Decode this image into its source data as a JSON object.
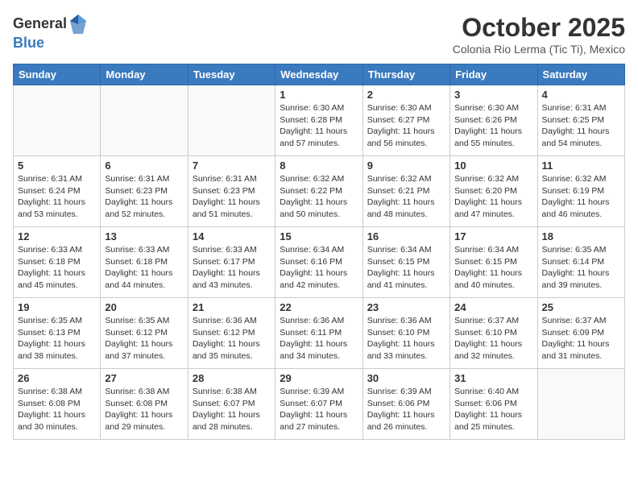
{
  "header": {
    "logo_general": "General",
    "logo_blue": "Blue",
    "month_title": "October 2025",
    "subtitle": "Colonia Rio Lerma (Tic Ti), Mexico"
  },
  "weekdays": [
    "Sunday",
    "Monday",
    "Tuesday",
    "Wednesday",
    "Thursday",
    "Friday",
    "Saturday"
  ],
  "weeks": [
    [
      {
        "day": "",
        "info": ""
      },
      {
        "day": "",
        "info": ""
      },
      {
        "day": "",
        "info": ""
      },
      {
        "day": "1",
        "info": "Sunrise: 6:30 AM\nSunset: 6:28 PM\nDaylight: 11 hours\nand 57 minutes."
      },
      {
        "day": "2",
        "info": "Sunrise: 6:30 AM\nSunset: 6:27 PM\nDaylight: 11 hours\nand 56 minutes."
      },
      {
        "day": "3",
        "info": "Sunrise: 6:30 AM\nSunset: 6:26 PM\nDaylight: 11 hours\nand 55 minutes."
      },
      {
        "day": "4",
        "info": "Sunrise: 6:31 AM\nSunset: 6:25 PM\nDaylight: 11 hours\nand 54 minutes."
      }
    ],
    [
      {
        "day": "5",
        "info": "Sunrise: 6:31 AM\nSunset: 6:24 PM\nDaylight: 11 hours\nand 53 minutes."
      },
      {
        "day": "6",
        "info": "Sunrise: 6:31 AM\nSunset: 6:23 PM\nDaylight: 11 hours\nand 52 minutes."
      },
      {
        "day": "7",
        "info": "Sunrise: 6:31 AM\nSunset: 6:23 PM\nDaylight: 11 hours\nand 51 minutes."
      },
      {
        "day": "8",
        "info": "Sunrise: 6:32 AM\nSunset: 6:22 PM\nDaylight: 11 hours\nand 50 minutes."
      },
      {
        "day": "9",
        "info": "Sunrise: 6:32 AM\nSunset: 6:21 PM\nDaylight: 11 hours\nand 48 minutes."
      },
      {
        "day": "10",
        "info": "Sunrise: 6:32 AM\nSunset: 6:20 PM\nDaylight: 11 hours\nand 47 minutes."
      },
      {
        "day": "11",
        "info": "Sunrise: 6:32 AM\nSunset: 6:19 PM\nDaylight: 11 hours\nand 46 minutes."
      }
    ],
    [
      {
        "day": "12",
        "info": "Sunrise: 6:33 AM\nSunset: 6:18 PM\nDaylight: 11 hours\nand 45 minutes."
      },
      {
        "day": "13",
        "info": "Sunrise: 6:33 AM\nSunset: 6:18 PM\nDaylight: 11 hours\nand 44 minutes."
      },
      {
        "day": "14",
        "info": "Sunrise: 6:33 AM\nSunset: 6:17 PM\nDaylight: 11 hours\nand 43 minutes."
      },
      {
        "day": "15",
        "info": "Sunrise: 6:34 AM\nSunset: 6:16 PM\nDaylight: 11 hours\nand 42 minutes."
      },
      {
        "day": "16",
        "info": "Sunrise: 6:34 AM\nSunset: 6:15 PM\nDaylight: 11 hours\nand 41 minutes."
      },
      {
        "day": "17",
        "info": "Sunrise: 6:34 AM\nSunset: 6:15 PM\nDaylight: 11 hours\nand 40 minutes."
      },
      {
        "day": "18",
        "info": "Sunrise: 6:35 AM\nSunset: 6:14 PM\nDaylight: 11 hours\nand 39 minutes."
      }
    ],
    [
      {
        "day": "19",
        "info": "Sunrise: 6:35 AM\nSunset: 6:13 PM\nDaylight: 11 hours\nand 38 minutes."
      },
      {
        "day": "20",
        "info": "Sunrise: 6:35 AM\nSunset: 6:12 PM\nDaylight: 11 hours\nand 37 minutes."
      },
      {
        "day": "21",
        "info": "Sunrise: 6:36 AM\nSunset: 6:12 PM\nDaylight: 11 hours\nand 35 minutes."
      },
      {
        "day": "22",
        "info": "Sunrise: 6:36 AM\nSunset: 6:11 PM\nDaylight: 11 hours\nand 34 minutes."
      },
      {
        "day": "23",
        "info": "Sunrise: 6:36 AM\nSunset: 6:10 PM\nDaylight: 11 hours\nand 33 minutes."
      },
      {
        "day": "24",
        "info": "Sunrise: 6:37 AM\nSunset: 6:10 PM\nDaylight: 11 hours\nand 32 minutes."
      },
      {
        "day": "25",
        "info": "Sunrise: 6:37 AM\nSunset: 6:09 PM\nDaylight: 11 hours\nand 31 minutes."
      }
    ],
    [
      {
        "day": "26",
        "info": "Sunrise: 6:38 AM\nSunset: 6:08 PM\nDaylight: 11 hours\nand 30 minutes."
      },
      {
        "day": "27",
        "info": "Sunrise: 6:38 AM\nSunset: 6:08 PM\nDaylight: 11 hours\nand 29 minutes."
      },
      {
        "day": "28",
        "info": "Sunrise: 6:38 AM\nSunset: 6:07 PM\nDaylight: 11 hours\nand 28 minutes."
      },
      {
        "day": "29",
        "info": "Sunrise: 6:39 AM\nSunset: 6:07 PM\nDaylight: 11 hours\nand 27 minutes."
      },
      {
        "day": "30",
        "info": "Sunrise: 6:39 AM\nSunset: 6:06 PM\nDaylight: 11 hours\nand 26 minutes."
      },
      {
        "day": "31",
        "info": "Sunrise: 6:40 AM\nSunset: 6:06 PM\nDaylight: 11 hours\nand 25 minutes."
      },
      {
        "day": "",
        "info": ""
      }
    ]
  ]
}
